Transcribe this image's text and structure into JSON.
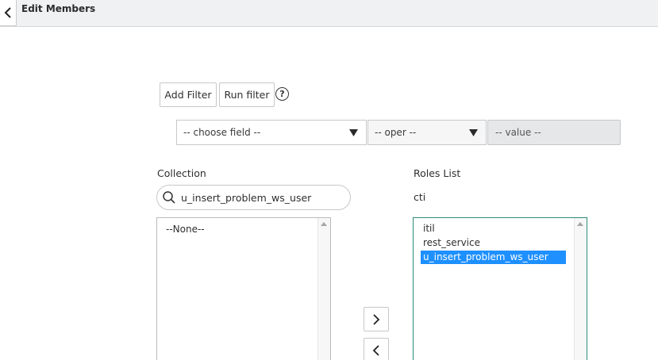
{
  "header": {
    "title": "Edit Members",
    "back_icon": "chevron-left-icon"
  },
  "filter": {
    "add_filter_label": "Add Filter",
    "run_filter_label": "Run filter",
    "help_symbol": "?",
    "field_select": "-- choose field --",
    "oper_select": "-- oper --",
    "value_placeholder": "-- value --"
  },
  "collection": {
    "label": "Collection",
    "search_value": "u_insert_problem_ws_user",
    "items": [
      "--None--"
    ]
  },
  "roles": {
    "label": "Roles List",
    "subtitle": "cti",
    "items": [
      "itil",
      "rest_service",
      "u_insert_problem_ws_user"
    ],
    "selected_index": 2
  },
  "colors": {
    "selection": "#1e90ff",
    "focus_border": "#2e8b7a",
    "header_bg": "#f0f1f2"
  }
}
